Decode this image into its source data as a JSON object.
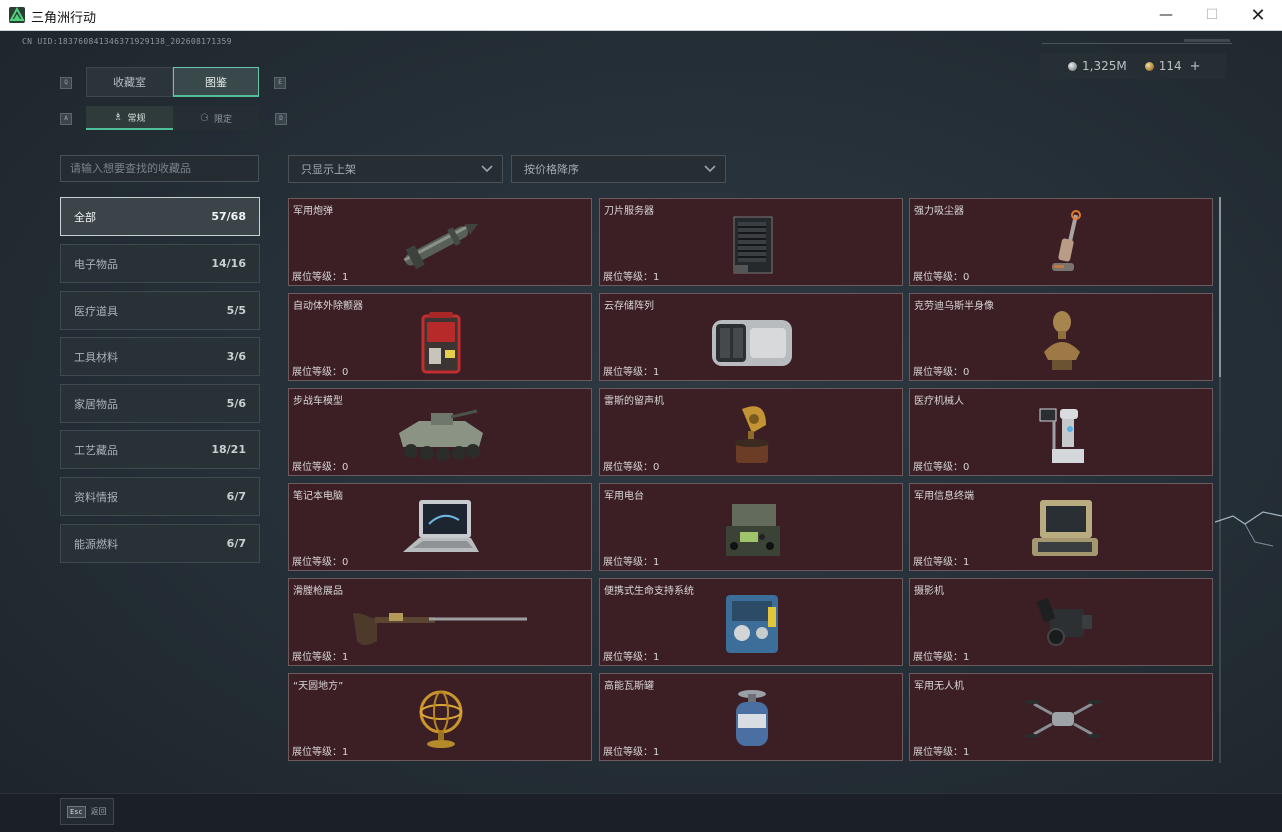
{
  "window": {
    "title": "三角洲行动",
    "min_glyph": "—",
    "max_glyph": "☐",
    "close_glyph": "✕"
  },
  "uid": "CN UID:18376084134637192913​8_202608171359",
  "currency": {
    "silver": "1,325M",
    "gold": "114",
    "plus": "+"
  },
  "keys": {
    "q": "Q",
    "e": "E",
    "a": "A",
    "d": "D"
  },
  "tabs": [
    {
      "label": "收藏室",
      "active": false
    },
    {
      "label": "图鉴",
      "active": true
    }
  ],
  "subtabs": [
    {
      "label": "常规",
      "icon": "♗",
      "active": true
    },
    {
      "label": "限定",
      "icon": "⚆",
      "active": false
    }
  ],
  "search": {
    "placeholder": "请输入想要查找的收藏品"
  },
  "filters": [
    {
      "value": "只显示上架"
    },
    {
      "value": "按价格降序"
    }
  ],
  "categories": [
    {
      "label": "全部",
      "count": "57/68",
      "active": true
    },
    {
      "label": "电子物品",
      "count": "14/16"
    },
    {
      "label": "医疗道具",
      "count": "5/5"
    },
    {
      "label": "工具材料",
      "count": "3/6"
    },
    {
      "label": "家居物品",
      "count": "5/6"
    },
    {
      "label": "工艺藏品",
      "count": "18/21"
    },
    {
      "label": "资料情报",
      "count": "6/7"
    },
    {
      "label": "能源燃料",
      "count": "6/7"
    }
  ],
  "items": [
    {
      "name": "军用炮弹",
      "level": "展位等级：1",
      "icon": "missile-icon"
    },
    {
      "name": "刀片服务器",
      "level": "展位等级：1",
      "icon": "server-icon"
    },
    {
      "name": "强力吸尘器",
      "level": "展位等级：0",
      "icon": "vacuum-icon"
    },
    {
      "name": "自动体外除颤器",
      "level": "展位等级：0",
      "icon": "defibrillator-icon"
    },
    {
      "name": "云存储阵列",
      "level": "展位等级：1",
      "icon": "storage-array-icon"
    },
    {
      "name": "克劳迪乌斯半身像",
      "level": "展位等级：0",
      "icon": "bust-icon"
    },
    {
      "name": "步战车模型",
      "level": "展位等级：0",
      "icon": "ifv-model-icon"
    },
    {
      "name": "雷斯的留声机",
      "level": "展位等级：0",
      "icon": "gramophone-icon"
    },
    {
      "name": "医疗机械人",
      "level": "展位等级：0",
      "icon": "medical-robot-icon"
    },
    {
      "name": "笔记本电脑",
      "level": "展位等级：0",
      "icon": "laptop-icon"
    },
    {
      "name": "军用电台",
      "level": "展位等级：1",
      "icon": "radio-icon"
    },
    {
      "name": "军用信息终端",
      "level": "展位等级：1",
      "icon": "terminal-icon"
    },
    {
      "name": "滑膛枪展品",
      "level": "展位等级：1",
      "icon": "musket-icon"
    },
    {
      "name": "便携式生命支持系统",
      "level": "展位等级：1",
      "icon": "life-support-icon"
    },
    {
      "name": "摄影机",
      "level": "展位等级：1",
      "icon": "camera-icon"
    },
    {
      "name": "“天圆地方”",
      "level": "展位等级：1",
      "icon": "armillary-sphere-icon"
    },
    {
      "name": "高能瓦斯罐",
      "level": "展位等级：1",
      "icon": "gas-canister-icon"
    },
    {
      "name": "军用无人机",
      "level": "展位等级：1",
      "icon": "drone-icon"
    }
  ],
  "footer": {
    "esc_key": "Esc",
    "back_label": "返回"
  }
}
